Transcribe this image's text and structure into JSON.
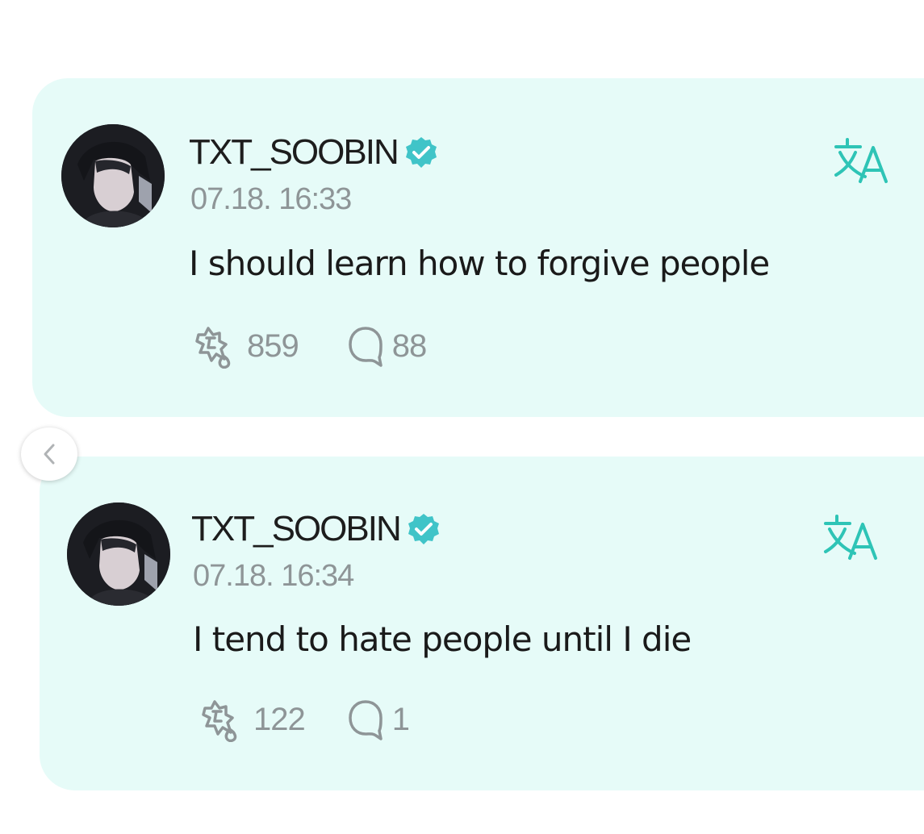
{
  "posts": [
    {
      "username": "TXT_SOOBIN",
      "timestamp": "07.18. 16:33",
      "message": "I should learn how to forgive people",
      "likes": "859",
      "comments": "88"
    },
    {
      "username": "TXT_SOOBIN",
      "timestamp": "07.18. 16:34",
      "message": "I tend to hate people until I die",
      "likes": "122",
      "comments": "1"
    }
  ],
  "colors": {
    "card_background": "#e6fbf8",
    "accent": "#2ec4b6",
    "verified_badge": "#40c4c8",
    "muted_text": "#8e9597"
  },
  "icons": {
    "verified": "verified-badge-icon",
    "translate": "translate-icon",
    "likes": "like-icon",
    "comments": "comment-icon",
    "previous": "chevron-left-icon"
  }
}
